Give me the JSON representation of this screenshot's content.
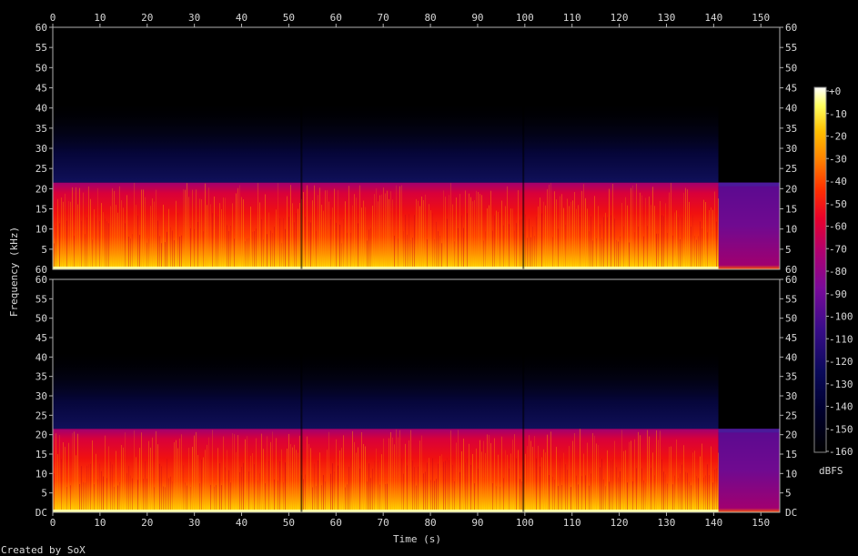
{
  "chart_data": {
    "type": "heatmap",
    "title": "",
    "xlabel": "Time (s)",
    "ylabel": "Frequency (kHz)",
    "credit": "Created by SoX",
    "xlim": [
      0,
      154
    ],
    "x_ticks": [
      0,
      10,
      20,
      30,
      40,
      50,
      60,
      70,
      80,
      90,
      100,
      110,
      120,
      130,
      140,
      150
    ],
    "ylim": [
      0,
      60
    ],
    "y_ticks": [
      5,
      10,
      15,
      20,
      25,
      30,
      35,
      40,
      45,
      50,
      55,
      60
    ],
    "y_bottom_label_top_channel": "60",
    "y_bottom_label_bottom_channel": "DC",
    "channels": 2,
    "content_bandwidth_khz": 21.5,
    "audio_end_s": 141,
    "colorbar": {
      "label": "dBFS",
      "min": -160,
      "max": 0,
      "ticks": [
        "+0",
        "-10",
        "-20",
        "-30",
        "-40",
        "-50",
        "-60",
        "-70",
        "-80",
        "-90",
        "-100",
        "-110",
        "-120",
        "-130",
        "-140",
        "-150",
        "-160"
      ]
    }
  }
}
